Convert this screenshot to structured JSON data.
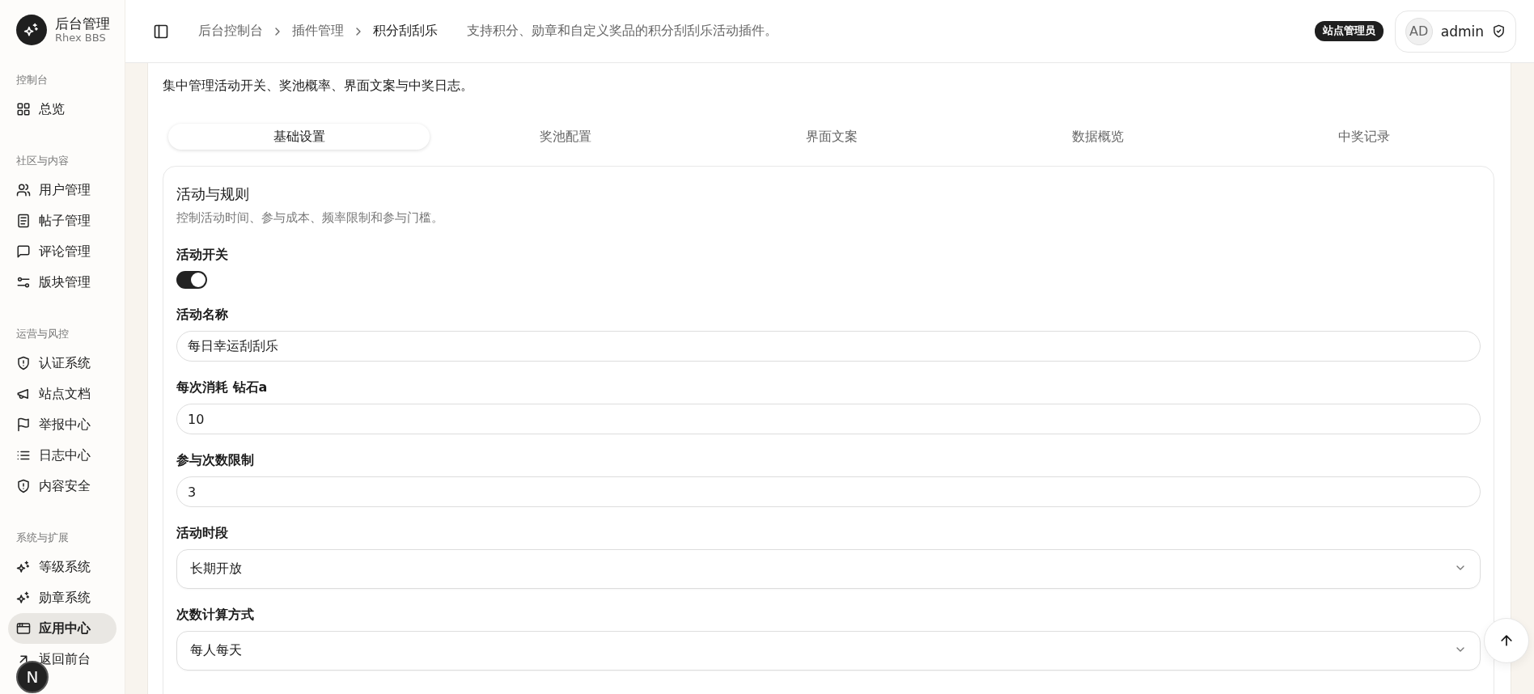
{
  "sidebar": {
    "brand": {
      "title": "后台管理",
      "subtitle": "Rhex BBS"
    },
    "sections": [
      {
        "title": "控制台",
        "items": [
          {
            "label": "总览",
            "selected": false
          }
        ]
      },
      {
        "title": "社区与内容",
        "items": [
          {
            "label": "用户管理",
            "selected": false
          },
          {
            "label": "帖子管理",
            "selected": false
          },
          {
            "label": "评论管理",
            "selected": false
          },
          {
            "label": "版块管理",
            "selected": false
          }
        ]
      },
      {
        "title": "运营与风控",
        "items": [
          {
            "label": "认证系统",
            "selected": false
          },
          {
            "label": "站点文档",
            "selected": false
          },
          {
            "label": "举报中心",
            "selected": false
          },
          {
            "label": "日志中心",
            "selected": false
          },
          {
            "label": "内容安全",
            "selected": false
          }
        ]
      },
      {
        "title": "系统与扩展",
        "items": [
          {
            "label": "等级系统",
            "selected": false
          },
          {
            "label": "勋章系统",
            "selected": false
          },
          {
            "label": "应用中心",
            "selected": true
          }
        ]
      }
    ],
    "footer_item": {
      "label": "返回前台"
    }
  },
  "dev_badge": "N",
  "header": {
    "breadcrumbs": [
      "后台控制台",
      "插件管理",
      "积分刮刮乐"
    ],
    "description": "支持积分、勋章和自定义奖品的积分刮刮乐活动插件。",
    "role_badge": "站点管理员",
    "user": {
      "initials": "AD",
      "name": "admin"
    }
  },
  "page": {
    "intro": "集中管理活动开关、奖池概率、界面文案与中奖日志。",
    "tabs": [
      {
        "label": "基础设置",
        "selected": true
      },
      {
        "label": "奖池配置",
        "selected": false
      },
      {
        "label": "界面文案",
        "selected": false
      },
      {
        "label": "数据概览",
        "selected": false
      },
      {
        "label": "中奖记录",
        "selected": false
      }
    ],
    "section": {
      "title": "活动与规则",
      "subtitle": "控制活动时间、参与成本、频率限制和参与门槛。",
      "fields": [
        {
          "kind": "switch",
          "label": "活动开关",
          "on": true
        },
        {
          "kind": "text",
          "label": "活动名称",
          "value": "每日幸运刮刮乐"
        },
        {
          "kind": "text",
          "label": "每次消耗 钻石a",
          "value": "10"
        },
        {
          "kind": "text",
          "label": "参与次数限制",
          "value": "3"
        },
        {
          "kind": "select",
          "label": "活动时段",
          "value": "长期开放"
        },
        {
          "kind": "select",
          "label": "次数计算方式",
          "value": "每人每天"
        }
      ]
    }
  }
}
